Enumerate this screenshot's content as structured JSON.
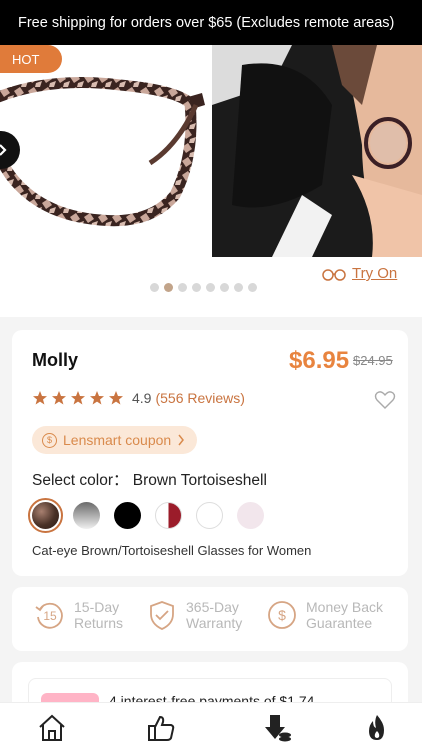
{
  "banner": {
    "text": "Free shipping for orders over $65 (Excludes remote areas)"
  },
  "gallery": {
    "badge": "HOT",
    "try_on_label": "Try On",
    "dot_count": 8,
    "active_dot": 1
  },
  "product": {
    "name": "Molly",
    "price": "$6.95",
    "original_price": "$24.95",
    "rating": "4.9",
    "reviews": "(556 Reviews)",
    "star_count": 5,
    "coupon_label": "Lensmart coupon",
    "coupon_icon": "$",
    "select_color_label": "Select color：",
    "selected_color": "Brown Tortoiseshell",
    "swatches": [
      {
        "name": "brown-tortoiseshell",
        "color": "#4a3228"
      },
      {
        "name": "gray-gradient",
        "color": "#9a9a9a"
      },
      {
        "name": "black",
        "color": "#000000"
      },
      {
        "name": "red-white",
        "color": "#9b1c2a"
      },
      {
        "name": "clear",
        "color": "#ffffff"
      },
      {
        "name": "pink",
        "color": "#f2e6ec"
      }
    ],
    "description": "Cat-eye Brown/Tortoiseshell Glasses for Women"
  },
  "guarantees": [
    {
      "icon": "15-day-returns-icon",
      "icon_text": "15",
      "line1": "15-Day",
      "line2": "Returns"
    },
    {
      "icon": "shield-check-icon",
      "line1": "365-Day",
      "line2": "Warranty"
    },
    {
      "icon": "money-back-icon",
      "icon_text": "$",
      "line1": "Money Back",
      "line2": "Guarantee"
    }
  ],
  "payment": {
    "text": "4 interest-free payments of $1.74"
  },
  "nav": [
    "home-icon",
    "thumbs-up-icon",
    "deals-icon",
    "hot-icon"
  ],
  "colors": {
    "accent": "#e8843f",
    "link": "#c97440",
    "banner_bg": "#000000"
  }
}
